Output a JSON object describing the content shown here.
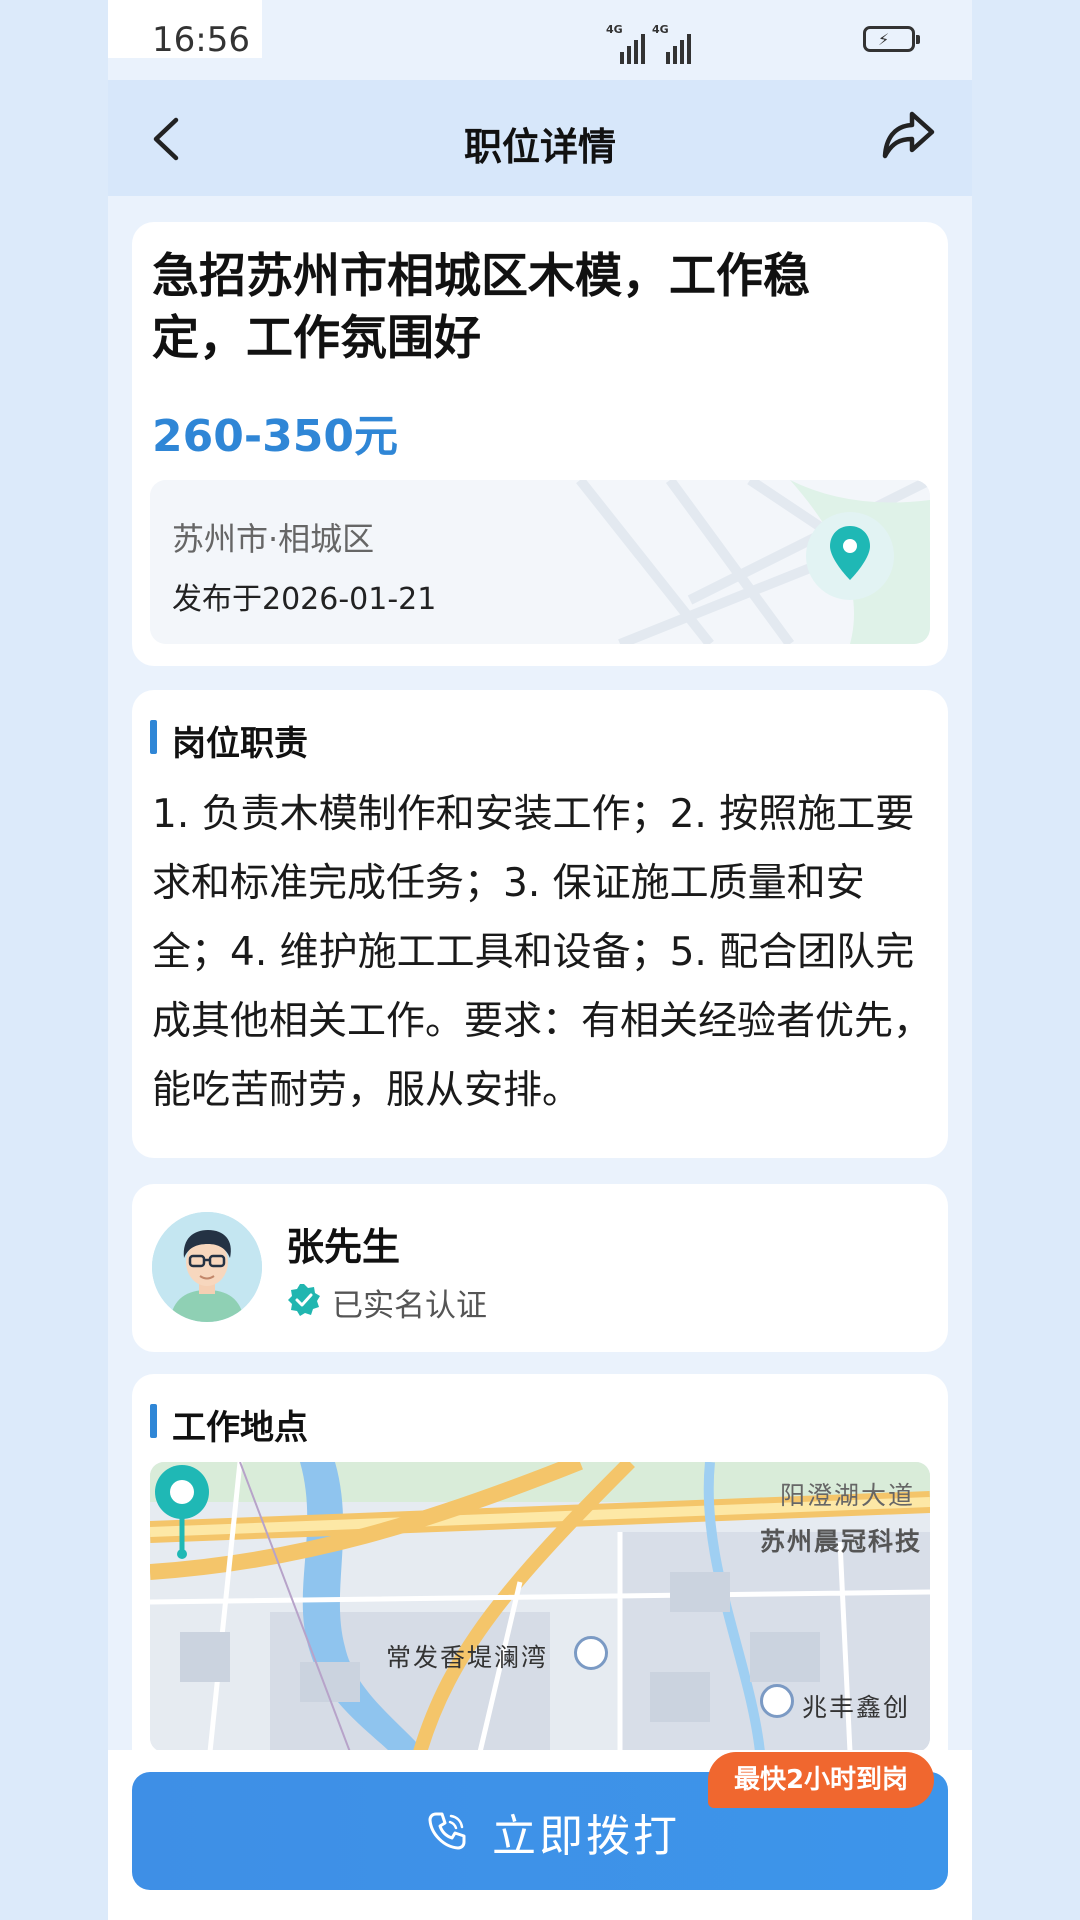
{
  "status_bar": {
    "time": "16:56",
    "signal1": "4G",
    "signal2": "4G"
  },
  "nav": {
    "title": "职位详情",
    "back_icon": "chevron-left-icon",
    "share_icon": "share-icon"
  },
  "job": {
    "title": "急招苏州市相城区木模，工作稳定，工作氛围好",
    "salary": "260-350元",
    "location": "苏州市·相城区",
    "published": "发布于2026-01-21"
  },
  "duties": {
    "heading": "岗位职责",
    "text": "1. 负责木模制作和安装工作；2. 按照施工要求和标准完成任务；3. 保证施工质量和安全；4. 维护施工工具和设备；5. 配合团队完成其他相关工作。要求：有相关经验者优先，能吃苦耐劳，服从安排。"
  },
  "contact": {
    "name": "张先生",
    "verified": "已实名认证"
  },
  "work_location": {
    "heading": "工作地点",
    "map_labels": {
      "road": "阳澄湖大道",
      "company": "苏州晨冠科技",
      "place1": "常发香堤澜湾",
      "place2": "兆丰鑫创"
    }
  },
  "action": {
    "call_label": "立即拨打",
    "badge": "最快2小时到岗"
  },
  "colors": {
    "accent": "#2f86d6",
    "badge": "#f0672f",
    "pin": "#1fb8b5"
  }
}
